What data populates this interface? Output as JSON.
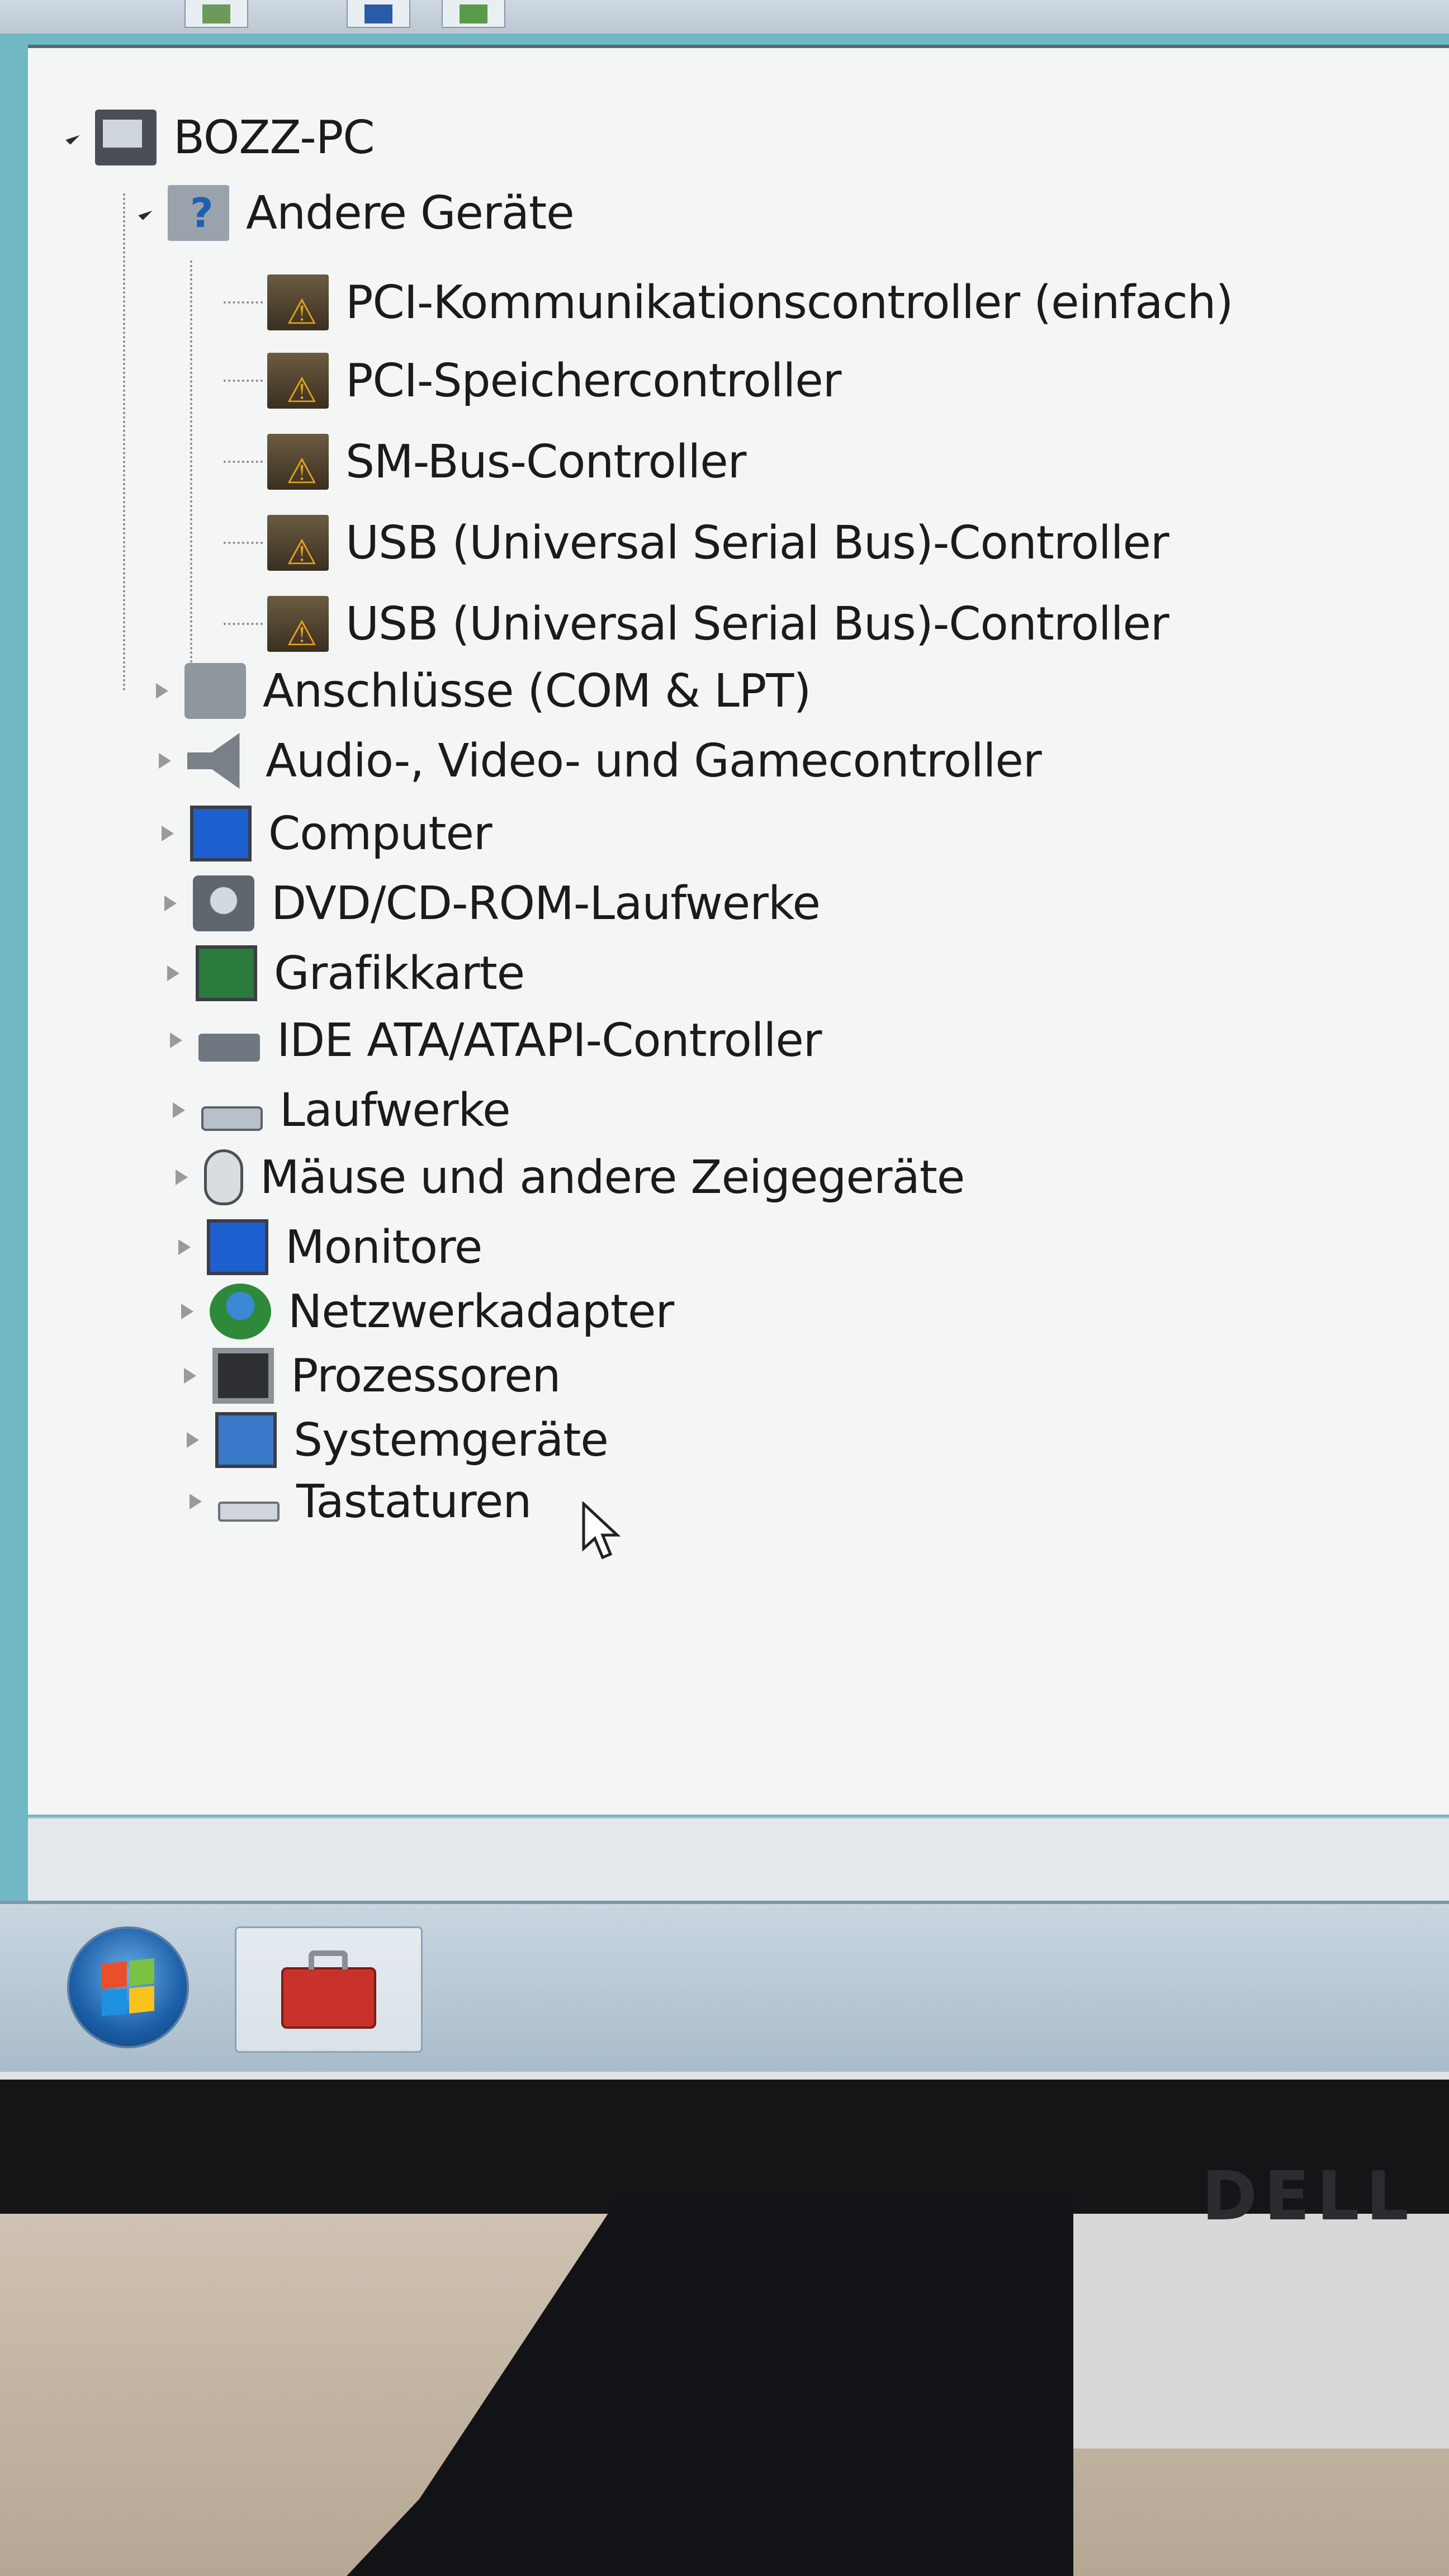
{
  "computer": {
    "name": "BOZZ-PC"
  },
  "tree": {
    "other_devices": {
      "label": "Andere Geräte",
      "children": [
        "PCI-Kommunikationscontroller (einfach)",
        "PCI-Speichercontroller",
        "SM-Bus-Controller",
        "USB (Universal Serial Bus)-Controller",
        "USB (Universal Serial Bus)-Controller"
      ]
    },
    "categories": [
      {
        "label": "Anschlüsse (COM & LPT)",
        "icon": "port-icon"
      },
      {
        "label": "Audio-, Video- und Gamecontroller",
        "icon": "speaker-icon"
      },
      {
        "label": "Computer",
        "icon": "computer-icon"
      },
      {
        "label": "DVD/CD-ROM-Laufwerke",
        "icon": "dvd-drive-icon"
      },
      {
        "label": "Grafikkarte",
        "icon": "display-adapter-icon"
      },
      {
        "label": "IDE ATA/ATAPI-Controller",
        "icon": "ide-controller-icon"
      },
      {
        "label": "Laufwerke",
        "icon": "disk-drive-icon"
      },
      {
        "label": "Mäuse und andere Zeigegeräte",
        "icon": "mouse-icon"
      },
      {
        "label": "Monitore",
        "icon": "monitor-icon"
      },
      {
        "label": "Netzwerkadapter",
        "icon": "network-adapter-icon"
      },
      {
        "label": "Prozessoren",
        "icon": "processor-icon"
      },
      {
        "label": "Systemgeräte",
        "icon": "system-devices-icon"
      },
      {
        "label": "Tastaturen",
        "icon": "keyboard-icon"
      }
    ]
  },
  "monitor": {
    "brand": "DELL"
  },
  "colors": {
    "warning": "#e6a21a",
    "window_border": "#6fb8c4",
    "tree_background": "#f4f5f5"
  }
}
